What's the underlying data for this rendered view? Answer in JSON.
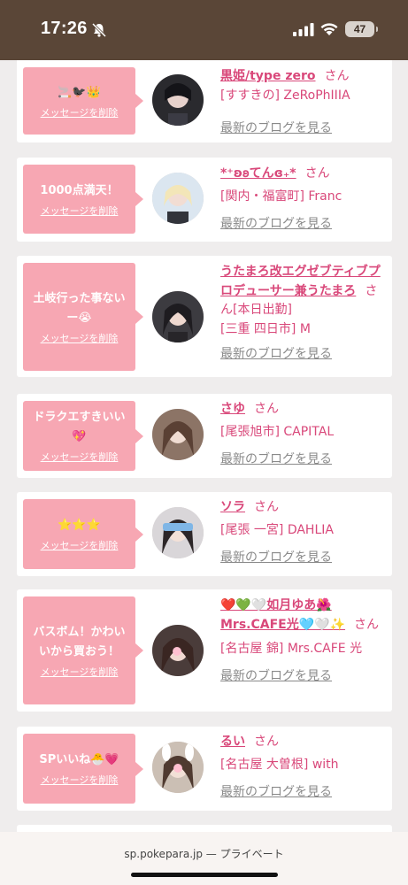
{
  "status_bar": {
    "time": "17:26",
    "battery": "47"
  },
  "delete_label": "メッセージを削除",
  "san_label": "さん",
  "blog_label": "最新のブログを見る",
  "cards": [
    {
      "message": "🚬🐦‍⬛👑",
      "name": "黒姫/type zero",
      "extra": "",
      "shop": "[すすきの] ZeRoPhIIIA"
    },
    {
      "message": "1000点満天！",
      "name": "*⁺ʚ𐐪てんɞ₊*",
      "extra": "",
      "shop": "[関内・福富町] Franc"
    },
    {
      "message": "土岐行った事ない ー😭",
      "name": "うたまろ改エグゼブティブプロデューサー兼うたまろ",
      "extra": "[本日出勤]",
      "shop": "[三重 四日市] M"
    },
    {
      "message": "ドラクエすきいい💖",
      "name": "さゆ",
      "extra": "",
      "shop": "[尾張旭市] CAPITAL"
    },
    {
      "message": "⭐⭐⭐",
      "name": "ソラ",
      "extra": "",
      "shop": "[尾張 一宮] DAHLIA"
    },
    {
      "message": "バスボム！かわいいから買おう！",
      "name": "❤️💚🤍如月ゆあ🌺Mrs.CAFE光🩵🤍✨",
      "extra": "",
      "shop": "[名古屋 錦] Mrs.CAFE 光"
    },
    {
      "message": "SPいいね🐣💗",
      "name": "るい",
      "extra": "",
      "shop": "[名古屋 大曽根] with"
    }
  ],
  "url_bar": {
    "text": "sp.pokepara.jp — プライベート"
  },
  "colors": {
    "accent": "#d9487a",
    "bubble": "#f7a7b3",
    "status_bar": "#5a4637"
  }
}
